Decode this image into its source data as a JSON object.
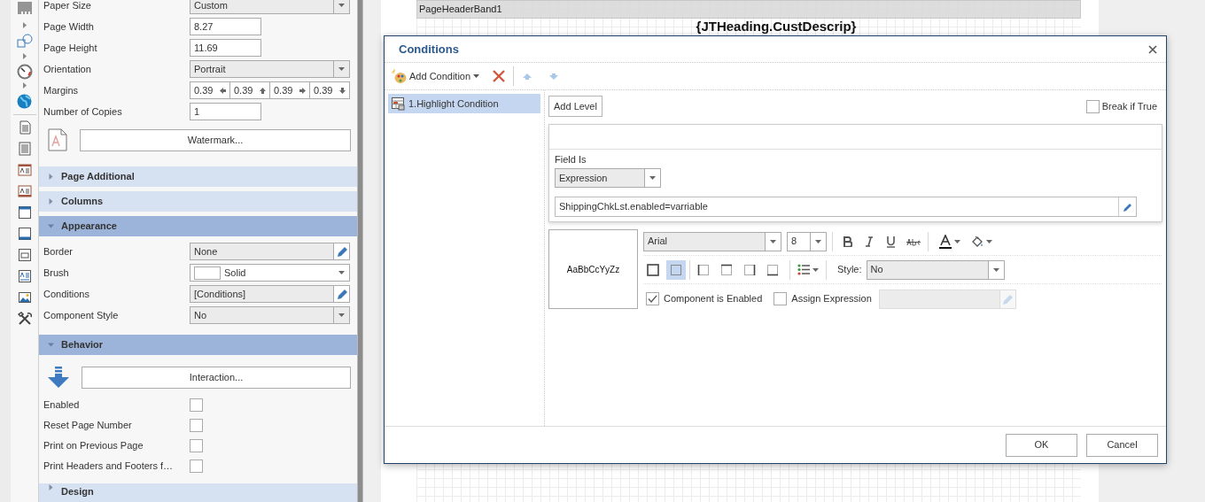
{
  "properties": [
    {
      "kind": "dropdown",
      "label": "Paper Size",
      "value": "Custom"
    },
    {
      "kind": "input",
      "label": "Page Width",
      "value": "8.27"
    },
    {
      "kind": "input",
      "label": "Page Height",
      "value": "11.69"
    },
    {
      "kind": "dropdown",
      "label": "Orientation",
      "value": "Portrait"
    },
    {
      "kind": "margins",
      "label": "Margins",
      "values": [
        "0.39",
        "0.39",
        "0.39",
        "0.39"
      ]
    },
    {
      "kind": "input",
      "label": "Number of Copies",
      "value": "1"
    },
    {
      "kind": "button",
      "label": "Watermark..."
    },
    {
      "kind": "section",
      "label": "Page Additional",
      "expanded": false
    },
    {
      "kind": "section",
      "label": "Columns",
      "expanded": false
    },
    {
      "kind": "section",
      "label": "Appearance",
      "expanded": true
    },
    {
      "kind": "editor",
      "label": "Border",
      "value": "None"
    },
    {
      "kind": "brush",
      "label": "Brush",
      "value": "Solid"
    },
    {
      "kind": "editor",
      "label": "Conditions",
      "value": "[Conditions]"
    },
    {
      "kind": "dropdown",
      "label": "Component Style",
      "value": "No"
    },
    {
      "kind": "section",
      "label": "Behavior",
      "expanded": true
    },
    {
      "kind": "button",
      "label": "Interaction..."
    },
    {
      "kind": "checkbox",
      "label": "Enabled",
      "checked": false
    },
    {
      "kind": "checkbox",
      "label": "Reset Page Number",
      "checked": false
    },
    {
      "kind": "checkbox",
      "label": "Print on Previous Page",
      "checked": false
    },
    {
      "kind": "checkbox",
      "label": "Print Headers and Footers f…",
      "checked": false
    },
    {
      "kind": "section",
      "label": "Design",
      "expanded": false
    }
  ],
  "band": {
    "title": "PageHeaderBand1",
    "heading": "{JTHeading.CustDescrip}"
  },
  "dialog": {
    "title": "Conditions",
    "add_condition": "Add Condition",
    "conditions": [
      {
        "label": "1.Highlight Condition",
        "selected": true
      }
    ],
    "add_level": "Add Level",
    "break_if_true": {
      "label": "Break if True",
      "checked": false
    },
    "field_is": {
      "label": "Field Is",
      "value": "Expression"
    },
    "expression": "ShippingChkLst.enabled=varriable",
    "preview": "AaBbCcYyZz",
    "font": {
      "family": "Arial",
      "size": "8"
    },
    "border_buttons": [
      {
        "kind": "all",
        "selected": false
      },
      {
        "kind": "none",
        "selected": true
      },
      {
        "kind": "left",
        "selected": false
      },
      {
        "kind": "top",
        "selected": false
      },
      {
        "kind": "right",
        "selected": false
      },
      {
        "kind": "bottom",
        "selected": false
      }
    ],
    "style": {
      "label": "Style:",
      "value": "No"
    },
    "component_enabled": {
      "label": "Component is Enabled",
      "checked": true
    },
    "assign_expression": {
      "label": "Assign Expression",
      "checked": false
    },
    "buttons": [
      "OK",
      "Cancel"
    ]
  }
}
